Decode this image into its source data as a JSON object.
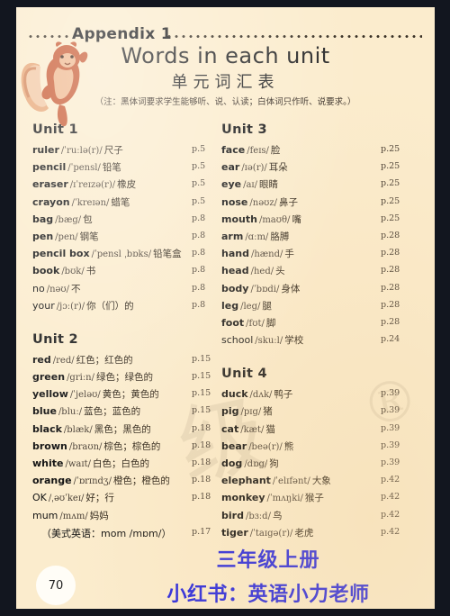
{
  "header": {
    "appendix_label": "Appendix 1",
    "title_en": "Words in each unit",
    "title_cn": "单元词汇表",
    "note": "（注：黑体词要求学生能够听、说、认读；白体词只作听、说要求。）",
    "mascot_icon": "squirrel-icon"
  },
  "watermark": {
    "text": "级",
    "mark": "®"
  },
  "columns": {
    "left": [
      {
        "unit": "Unit 1",
        "entries": [
          {
            "word": "ruler",
            "bold": true,
            "ipa": "/ˈruːlə(r)/",
            "cn": "尺子",
            "page": "p.5"
          },
          {
            "word": "pencil",
            "bold": true,
            "ipa": "/ˈpensl/",
            "cn": "铅笔",
            "page": "p.5"
          },
          {
            "word": "eraser",
            "bold": true,
            "ipa": "/ɪˈreɪzə(r)/",
            "cn": "橡皮",
            "page": "p.5"
          },
          {
            "word": "crayon",
            "bold": true,
            "ipa": "/ˈkreɪən/",
            "cn": "蜡笔",
            "page": "p.5"
          },
          {
            "word": "bag",
            "bold": true,
            "ipa": "/bæg/",
            "cn": "包",
            "page": "p.8"
          },
          {
            "word": "pen",
            "bold": true,
            "ipa": "/pen/",
            "cn": "钢笔",
            "page": "p.8"
          },
          {
            "word": "pencil box",
            "bold": true,
            "ipa": "/ˈpensl ˌbɒks/",
            "cn": "铅笔盒",
            "page": "p.8"
          },
          {
            "word": "book",
            "bold": true,
            "ipa": "/bʊk/",
            "cn": "书",
            "page": "p.8"
          },
          {
            "word": "no",
            "bold": false,
            "ipa": "/nəʊ/",
            "cn": "不",
            "page": "p.8"
          },
          {
            "word": "your",
            "bold": false,
            "ipa": "/jɔː(r)/",
            "cn": "你（们）的",
            "page": "p.8"
          }
        ]
      },
      {
        "unit": "Unit 2",
        "entries": [
          {
            "word": "red",
            "bold": true,
            "ipa": "/red/",
            "cn": "红色；红色的",
            "page": "p.15"
          },
          {
            "word": "green",
            "bold": true,
            "ipa": "/griːn/",
            "cn": "绿色；绿色的",
            "page": "p.15"
          },
          {
            "word": "yellow",
            "bold": true,
            "ipa": "/ˈjeləʊ/",
            "cn": "黄色；黄色的",
            "page": "p.15"
          },
          {
            "word": "blue",
            "bold": true,
            "ipa": "/bluː/",
            "cn": "蓝色；蓝色的",
            "page": "p.15"
          },
          {
            "word": "black",
            "bold": true,
            "ipa": "/blæk/",
            "cn": "黑色；黑色的",
            "page": "p.18"
          },
          {
            "word": "brown",
            "bold": true,
            "ipa": "/braʊn/",
            "cn": "棕色；棕色的",
            "page": "p.18"
          },
          {
            "word": "white",
            "bold": true,
            "ipa": "/waɪt/",
            "cn": "白色；白色的",
            "page": "p.18"
          },
          {
            "word": "orange",
            "bold": true,
            "ipa": "/ˈɒrɪndʒ/",
            "cn": "橙色；橙色的",
            "page": "p.18"
          },
          {
            "word": "OK",
            "bold": false,
            "ipa": "/ˌəʊˈkeɪ/",
            "cn": "好；行",
            "page": "p.18"
          },
          {
            "word": "mum",
            "bold": false,
            "ipa": "/mʌm/",
            "cn": "妈妈",
            "page": ""
          },
          {
            "word": "（美式英语：mom /mɒm/）",
            "bold": false,
            "ipa": "",
            "cn": "",
            "page": "p.17",
            "sub": true
          }
        ]
      }
    ],
    "right": [
      {
        "unit": "Unit 3",
        "entries": [
          {
            "word": "face",
            "bold": true,
            "ipa": "/feɪs/",
            "cn": "脸",
            "page": "p.25"
          },
          {
            "word": "ear",
            "bold": true,
            "ipa": "/ɪə(r)/",
            "cn": "耳朵",
            "page": "p.25"
          },
          {
            "word": "eye",
            "bold": true,
            "ipa": "/aɪ/",
            "cn": "眼睛",
            "page": "p.25"
          },
          {
            "word": "nose",
            "bold": true,
            "ipa": "/nəʊz/",
            "cn": "鼻子",
            "page": "p.25"
          },
          {
            "word": "mouth",
            "bold": true,
            "ipa": "/maʊθ/",
            "cn": "嘴",
            "page": "p.25"
          },
          {
            "word": "arm",
            "bold": true,
            "ipa": "/ɑːm/",
            "cn": "胳膊",
            "page": "p.28"
          },
          {
            "word": "hand",
            "bold": true,
            "ipa": "/hænd/",
            "cn": "手",
            "page": "p.28"
          },
          {
            "word": "head",
            "bold": true,
            "ipa": "/hed/",
            "cn": "头",
            "page": "p.28"
          },
          {
            "word": "body",
            "bold": true,
            "ipa": "/ˈbɒdi/",
            "cn": "身体",
            "page": "p.28"
          },
          {
            "word": "leg",
            "bold": true,
            "ipa": "/leg/",
            "cn": "腿",
            "page": "p.28"
          },
          {
            "word": "foot",
            "bold": true,
            "ipa": "/fʊt/",
            "cn": "脚",
            "page": "p.28"
          },
          {
            "word": "school",
            "bold": false,
            "ipa": "/skuːl/",
            "cn": "学校",
            "page": "p.24"
          }
        ]
      },
      {
        "unit": "Unit 4",
        "entries": [
          {
            "word": "duck",
            "bold": true,
            "ipa": "/dʌk/",
            "cn": "鸭子",
            "page": "p.39"
          },
          {
            "word": "pig",
            "bold": true,
            "ipa": "/pɪg/",
            "cn": "猪",
            "page": "p.39"
          },
          {
            "word": "cat",
            "bold": true,
            "ipa": "/kæt/",
            "cn": "猫",
            "page": "p.39"
          },
          {
            "word": "bear",
            "bold": true,
            "ipa": "/beə(r)/",
            "cn": "熊",
            "page": "p.39"
          },
          {
            "word": "dog",
            "bold": true,
            "ipa": "/dɒg/",
            "cn": "狗",
            "page": "p.39"
          },
          {
            "word": "elephant",
            "bold": true,
            "ipa": "/ˈelɪfənt/",
            "cn": "大象",
            "page": "p.42"
          },
          {
            "word": "monkey",
            "bold": true,
            "ipa": "/ˈmʌŋki/",
            "cn": "猴子",
            "page": "p.42"
          },
          {
            "word": "bird",
            "bold": true,
            "ipa": "/bɜːd/",
            "cn": "鸟",
            "page": "p.42"
          },
          {
            "word": "tiger",
            "bold": true,
            "ipa": "/ˈtaɪgə(r)/",
            "cn": "老虎",
            "page": "p.42"
          }
        ]
      }
    ]
  },
  "footer": {
    "page_number": "70",
    "promo_line1": "三年级上册",
    "promo_line2": "小红书：英语小力老师",
    "promo_color": "#2727e0"
  }
}
